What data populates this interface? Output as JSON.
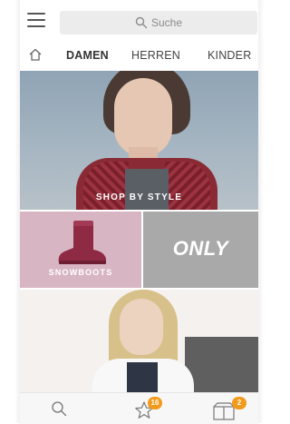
{
  "search": {
    "placeholder": "Suche"
  },
  "tabs": [
    {
      "label": "DAMEN",
      "active": true
    },
    {
      "label": "HERREN",
      "active": false
    },
    {
      "label": "KINDER",
      "active": false
    }
  ],
  "hero": {
    "caption": "SHOP BY STYLE"
  },
  "tiles": {
    "snowboots": {
      "label": "SNOWBOOTS"
    },
    "only": {
      "logo": "ONLY"
    }
  },
  "bottom_bar": {
    "favorites_count": "16",
    "cart_count": "2"
  },
  "colors": {
    "badge": "#f29a1b",
    "snowboots_tile": "#d8b5c3",
    "only_tile": "#a9a9a9",
    "boot": "#8e2a44"
  }
}
